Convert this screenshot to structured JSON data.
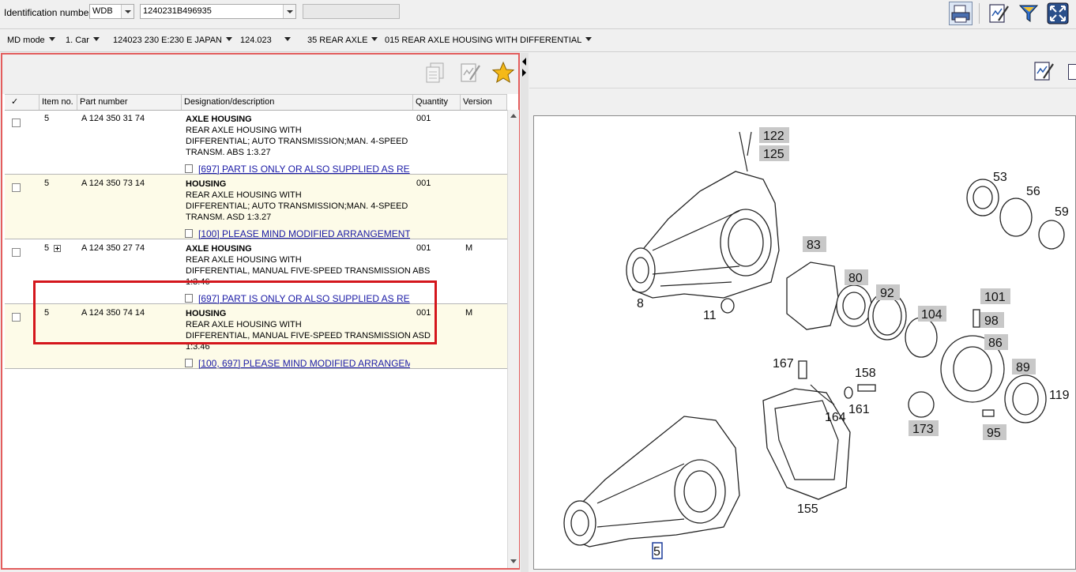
{
  "topbar": {
    "id_label": "Identification number",
    "prefix": "WDB",
    "vin": "1240231B496935"
  },
  "breadcrumb": [
    "MD mode",
    "1. Car",
    "124023 230 E:230 E JAPAN",
    "124.023",
    "35 REAR AXLE",
    "015 REAR AXLE HOUSING WITH DIFFERENTIAL"
  ],
  "table": {
    "headers": {
      "check": "✓",
      "item": "Item no.",
      "part": "Part number",
      "desc": "Designation/description",
      "qty": "Quantity",
      "version": "Version"
    },
    "rows": [
      {
        "item": "5",
        "part": "A 124 350 31 74",
        "title": "AXLE HOUSING",
        "line1": "REAR AXLE HOUSING WITH",
        "line2": "DIFFERENTIAL; AUTO TRANSMISSION;MAN. 4-SPEED",
        "line3": "TRANSM. ABS 1:3.27",
        "qty": "001",
        "version": "",
        "note": "[697] PART IS ONLY OR ALSO SUPPLIED AS RE"
      },
      {
        "item": "5",
        "part": "A 124 350 73 14",
        "title": "HOUSING",
        "line1": "REAR AXLE HOUSING WITH",
        "line2": "DIFFERENTIAL; AUTO TRANSMISSION;MAN. 4-SPEED",
        "line3": "TRANSM. ASD 1:3.27",
        "qty": "001",
        "version": "",
        "note": "[100] PLEASE MIND MODIFIED ARRANGEMENT"
      },
      {
        "item": "5",
        "part": "A 124 350 27 74",
        "title": "AXLE HOUSING",
        "line1": "REAR AXLE HOUSING WITH",
        "line2": "DIFFERENTIAL, MANUAL FIVE-SPEED TRANSMISSION ABS",
        "line3": "1:3.46",
        "qty": "001",
        "version": "M",
        "note": "[697] PART IS ONLY OR ALSO SUPPLIED AS RE"
      },
      {
        "item": "5",
        "part": "A 124 350 74 14",
        "title": "HOUSING",
        "line1": "REAR AXLE HOUSING WITH",
        "line2": "DIFFERENTIAL, MANUAL FIVE-SPEED TRANSMISSION ASD",
        "line3": "1:3.46",
        "qty": "001",
        "version": "M",
        "note": "[100, 697] PLEASE MIND MODIFIED ARRANGEM"
      }
    ]
  },
  "diagram": {
    "labels": [
      "122",
      "125",
      "53",
      "56",
      "59",
      "8",
      "83",
      "80",
      "92",
      "101",
      "98",
      "104",
      "86",
      "11",
      "167",
      "158",
      "161",
      "164",
      "89",
      "119",
      "173",
      "95",
      "155",
      "5"
    ]
  },
  "colors": {
    "highlight": "#d4161c",
    "panel_border": "#e35d5d",
    "link": "#1a1aa6",
    "alt_row": "#fdfbe8"
  }
}
